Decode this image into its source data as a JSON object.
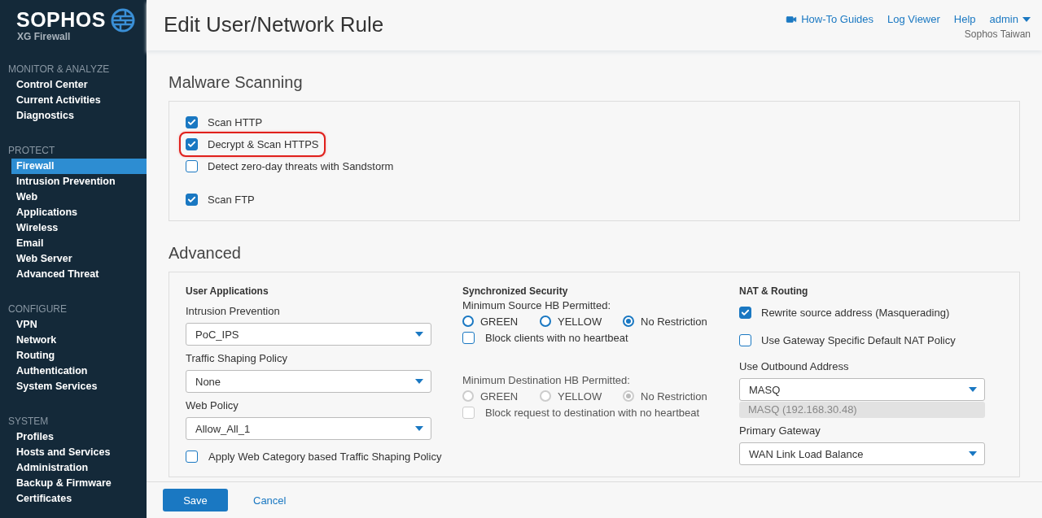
{
  "sidebar": {
    "logo": "SOPHOS",
    "product": "XG Firewall",
    "sections": [
      {
        "title": "MONITOR & ANALYZE",
        "items": [
          {
            "label": "Control Center",
            "selected": false
          },
          {
            "label": "Current Activities",
            "selected": false
          },
          {
            "label": "Diagnostics",
            "selected": false
          }
        ]
      },
      {
        "title": "PROTECT",
        "items": [
          {
            "label": "Firewall",
            "selected": true
          },
          {
            "label": "Intrusion Prevention",
            "selected": false
          },
          {
            "label": "Web",
            "selected": false
          },
          {
            "label": "Applications",
            "selected": false
          },
          {
            "label": "Wireless",
            "selected": false
          },
          {
            "label": "Email",
            "selected": false
          },
          {
            "label": "Web Server",
            "selected": false
          },
          {
            "label": "Advanced Threat",
            "selected": false
          }
        ]
      },
      {
        "title": "CONFIGURE",
        "items": [
          {
            "label": "VPN",
            "selected": false
          },
          {
            "label": "Network",
            "selected": false
          },
          {
            "label": "Routing",
            "selected": false
          },
          {
            "label": "Authentication",
            "selected": false
          },
          {
            "label": "System Services",
            "selected": false
          }
        ]
      },
      {
        "title": "SYSTEM",
        "items": [
          {
            "label": "Profiles",
            "selected": false
          },
          {
            "label": "Hosts and Services",
            "selected": false
          },
          {
            "label": "Administration",
            "selected": false
          },
          {
            "label": "Backup & Firmware",
            "selected": false
          },
          {
            "label": "Certificates",
            "selected": false
          }
        ]
      }
    ]
  },
  "header": {
    "title": "Edit User/Network Rule",
    "links": [
      {
        "label": "How-To Guides",
        "kind": "video"
      },
      {
        "label": "Log Viewer",
        "kind": "plain"
      },
      {
        "label": "Help",
        "kind": "plain"
      },
      {
        "label": "admin",
        "kind": "menu"
      }
    ],
    "subtitle": "Sophos Taiwan"
  },
  "malware": {
    "title": "Malware Scanning",
    "groups": [
      [
        {
          "label": "Scan HTTP",
          "checked": true,
          "highlighted": false
        },
        {
          "label": "Decrypt & Scan HTTPS",
          "checked": true,
          "highlighted": true
        },
        {
          "label": "Detect zero-day threats with Sandstorm",
          "checked": false,
          "highlighted": false
        }
      ],
      [
        {
          "label": "Scan FTP",
          "checked": true,
          "highlighted": false
        }
      ]
    ]
  },
  "advanced": {
    "title": "Advanced",
    "user_applications": {
      "title": "User Applications",
      "fields": [
        {
          "label": "Intrusion Prevention",
          "value": "PoC_IPS"
        },
        {
          "label": "Traffic Shaping Policy",
          "value": "None"
        },
        {
          "label": "Web Policy",
          "value": "Allow_All_1"
        }
      ],
      "checkbox": {
        "label": "Apply Web Category based Traffic Shaping Policy",
        "checked": false
      }
    },
    "synchronized_security": {
      "title": "Synchronized Security",
      "groups": [
        {
          "label": "Minimum Source HB Permitted:",
          "disabled": false,
          "options": [
            {
              "label": "GREEN",
              "selected": false
            },
            {
              "label": "YELLOW",
              "selected": false
            },
            {
              "label": "No Restriction",
              "selected": true
            }
          ],
          "checkbox": {
            "label": "Block clients with no heartbeat",
            "checked": false
          }
        },
        {
          "label": "Minimum Destination HB Permitted:",
          "disabled": true,
          "options": [
            {
              "label": "GREEN",
              "selected": false
            },
            {
              "label": "YELLOW",
              "selected": false
            },
            {
              "label": "No Restriction",
              "selected": true
            }
          ],
          "checkbox": {
            "label": "Block request to destination with no heartbeat",
            "checked": false
          }
        }
      ]
    },
    "nat_routing": {
      "title": "NAT & Routing",
      "checkboxes": [
        {
          "label": "Rewrite source address (Masquerading)",
          "checked": true
        },
        {
          "label": "Use Gateway Specific Default NAT Policy",
          "checked": false
        }
      ],
      "fields": [
        {
          "label": "Use Outbound Address",
          "value": "MASQ",
          "detail": "MASQ (192.168.30.48)"
        },
        {
          "label": "Primary Gateway",
          "value": "WAN Link Load Balance"
        }
      ]
    }
  },
  "footer": {
    "save": "Save",
    "cancel": "Cancel"
  }
}
